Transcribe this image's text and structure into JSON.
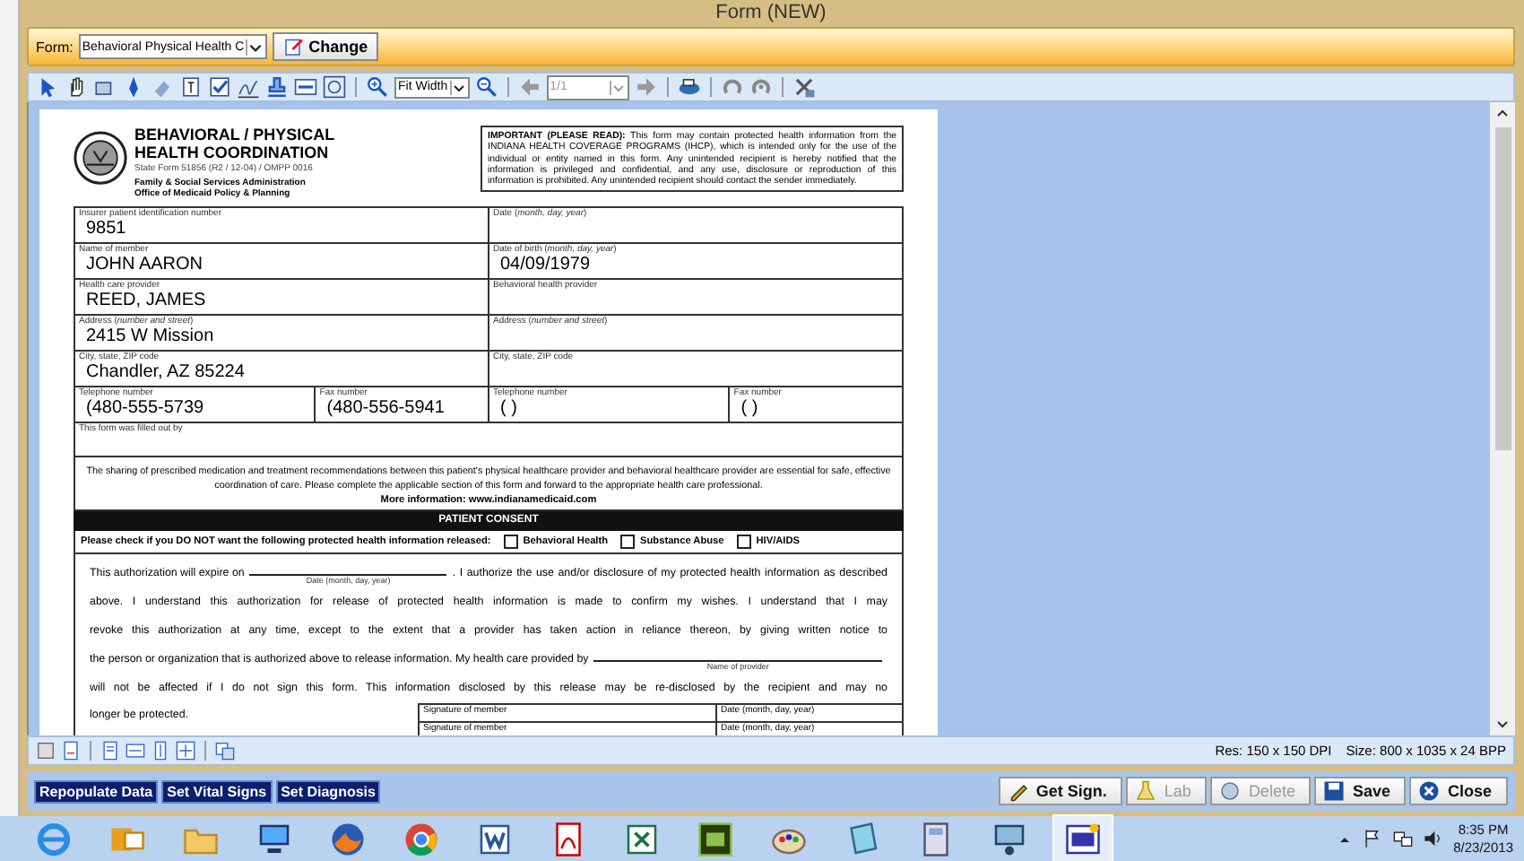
{
  "window": {
    "title": "Form (NEW)"
  },
  "form_bar": {
    "label": "Form:",
    "selected_form": "Behavioral Physical Health C",
    "change_button": "Change"
  },
  "toolbar": {
    "zoom": "Fit Width",
    "page": "1/1"
  },
  "document": {
    "header": {
      "title": "BEHAVIORAL / PHYSICAL HEALTH COORDINATION",
      "form_number": "State Form 51856 (R2 / 12-04) / OMPP 0016",
      "agency": "Family & Social Services Administration",
      "office": "Office of Medicaid Policy & Planning"
    },
    "notice": "**IMPORTANT (PLEASE READ):**  This form may contain protected health information from the INDIANA HEALTH COVERAGE PROGRAMS (IHCP), which is intended only for the use of the individual or entity named in this form.  Any unintended recipient is hereby notified that the information is privileged and confidential, and any use, disclosure or reproduction of this information is prohibited.  Any unintended recipient should contact the sender immediately.",
    "field_rows": [
      [
        {
          "label": "Insurer patient identification number",
          "value": "9851"
        },
        {
          "label": "Date (*month, day, year*)"
        }
      ],
      [
        {
          "label": "Name of member",
          "value": "JOHN AARON"
        },
        {
          "label": "Date of birth (*month, day, year*)",
          "value": "04/09/1979"
        }
      ],
      [
        {
          "label": "Health care provider",
          "value": "REED, JAMES"
        },
        {
          "label": "Behavioral health provider"
        }
      ],
      [
        {
          "label": "Address (*number and street*)",
          "value": "2415 W Mission"
        },
        {
          "label": "Address (*number and street*)"
        }
      ],
      [
        {
          "label": "City, state, ZIP code",
          "value": "Chandler, AZ 85224"
        },
        {
          "label": "City, state, ZIP code"
        }
      ],
      [
        {
          "label": "Telephone number",
          "value": "(480-555-5739"
        },
        {
          "label": "Fax number",
          "value": "(480-556-5941"
        },
        {
          "label": "Telephone number",
          "value": "(       )"
        },
        {
          "label": "Fax number",
          "value": "(       )"
        }
      ],
      [
        {
          "label": "This form was filled out by"
        }
      ]
    ],
    "info_text": "The sharing of prescribed medication and treatment recommendations between this patient's physical healthcare provider and behavioral healthcare provider are essential for safe, effective coordination of care.  Please complete the applicable section of this form and forward to the appropriate health care professional.",
    "more_info": "More information: www.indianamedicaid.com",
    "consent_title": "PATIENT CONSENT",
    "release_prompt": "Please check if you DO NOT want the following protected health information released:",
    "release_options": [
      {
        "label": "Behavioral Health",
        "checked": false
      },
      {
        "label": "Substance Abuse",
        "checked": false
      },
      {
        "label": "HIV/AIDS",
        "checked": false
      }
    ],
    "authorization_lines": [
      [
        {
          "kind": "text",
          "text": "This authorization will expire on"
        },
        {
          "kind": "blank",
          "caption": "Date (month, day, year)"
        },
        {
          "kind": "text",
          "text": ".  I authorize the use and/or disclosure of my protected health information as described"
        }
      ],
      [
        {
          "kind": "text",
          "text": "above.  I understand this authorization for release of protected health information is made to confirm my wishes.  I understand that I may"
        }
      ],
      [
        {
          "kind": "text",
          "text": "revoke this authorization at any time, except to the extent that a provider has taken action in reliance thereon, by giving written notice to"
        }
      ],
      [
        {
          "kind": "text",
          "text": "the person or organization that is authorized above to release information.  My health care provided by"
        },
        {
          "kind": "blank",
          "caption": "Name of provider"
        }
      ],
      [
        {
          "kind": "text",
          "text": "will not be affected if I do not sign this form.  This information disclosed by this release may be re-disclosed by the recipient and may no"
        }
      ]
    ],
    "authorization_end": "longer be protected.",
    "signature_rows": [
      {
        "signature": "Signature of member",
        "date": "Date (month, day, year)"
      },
      {
        "signature": "Signature of member",
        "date": "Date (month, day, year)"
      }
    ]
  },
  "status": {
    "resolution": "Res:  150 x 150 DPI",
    "size": "Size: 800 x 1035 x 24 BPP"
  },
  "actions_left": [
    "Repopulate Data",
    "Set Vital Signs",
    "Set Diagnosis"
  ],
  "actions_right": [
    {
      "label": "Get Sign.",
      "disabled": false
    },
    {
      "label": "Lab",
      "disabled": true
    },
    {
      "label": "Delete",
      "disabled": true
    },
    {
      "label": "Save",
      "disabled": false
    },
    {
      "label": "Close",
      "disabled": false
    }
  ],
  "taskbar": {
    "time": "8:35 PM",
    "date": "8/23/2013"
  }
}
